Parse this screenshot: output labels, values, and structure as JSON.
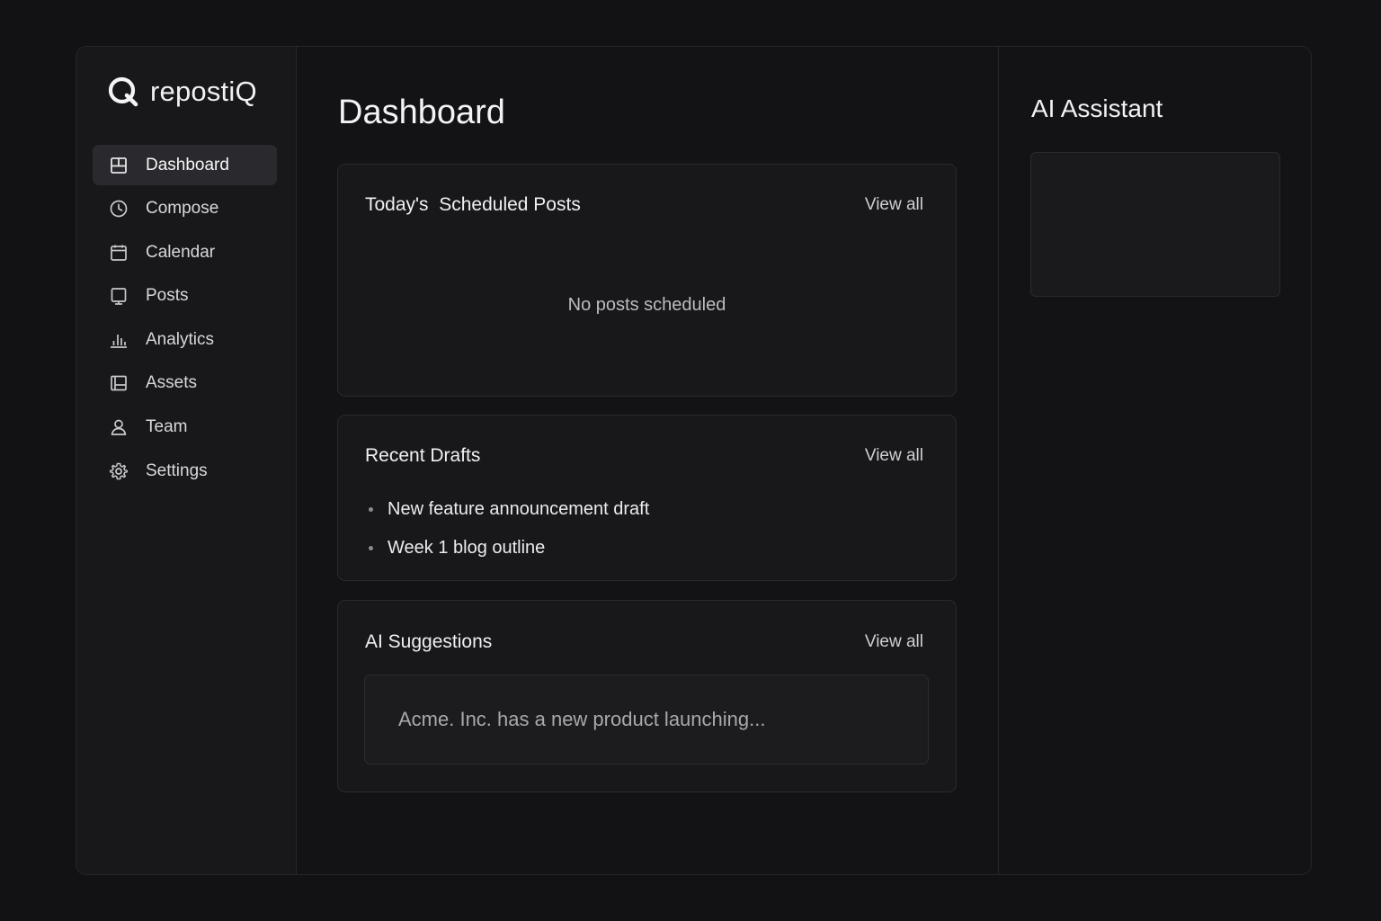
{
  "brand": {
    "name": "repostiQ",
    "logo_icon": "q-logo-icon"
  },
  "sidebar": {
    "items": [
      {
        "label": "Dashboard",
        "icon": "dashboard-icon",
        "active": true
      },
      {
        "label": "Compose",
        "icon": "clock-icon",
        "active": false
      },
      {
        "label": "Calendar",
        "icon": "calendar-icon",
        "active": false
      },
      {
        "label": "Posts",
        "icon": "posts-icon",
        "active": false
      },
      {
        "label": "Analytics",
        "icon": "bar-chart-icon",
        "active": false
      },
      {
        "label": "Assets",
        "icon": "image-icon",
        "active": false
      },
      {
        "label": "Team",
        "icon": "user-icon",
        "active": false
      },
      {
        "label": "Settings",
        "icon": "gear-icon",
        "active": false
      }
    ]
  },
  "main": {
    "title": "Dashboard",
    "scheduled": {
      "title": "Today's  Scheduled Posts",
      "view_all": "View all",
      "empty_text": "No posts scheduled"
    },
    "drafts": {
      "title": "Recent Drafts",
      "view_all": "View all",
      "items": [
        "New feature announcement draft",
        "Week 1 blog outline"
      ]
    },
    "suggestions": {
      "title": "AI Suggestions",
      "view_all": "View all",
      "placeholder": "Acme. Inc. has a new product launching..."
    }
  },
  "assistant": {
    "title": "AI Assistant"
  },
  "colors": {
    "background": "#121214",
    "panel": "#18181b",
    "active_item": "#2a2a2e",
    "text": "#e8e8ea",
    "muted_text": "#a8a8ad"
  }
}
